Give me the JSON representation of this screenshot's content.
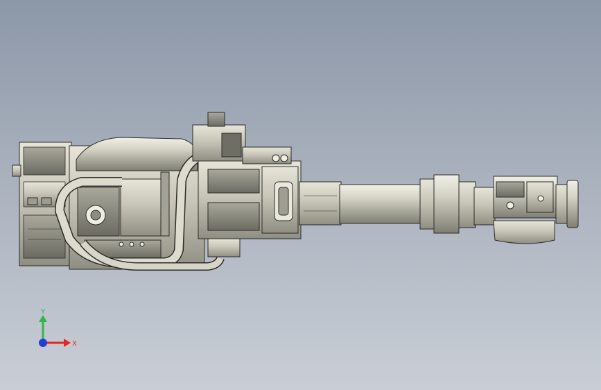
{
  "viewport": {
    "background_top": "#8c97a8",
    "background_bottom": "#c9ced6"
  },
  "model": {
    "name": "",
    "body_color": "#c7c6b8",
    "shadow_color": "#8f8e82",
    "line_color": "#2b2b28"
  },
  "triad": {
    "x_label": "X",
    "y_label": "Y",
    "x_color": "#e8251f",
    "y_color": "#2fb84a",
    "z_color": "#1f3fd6"
  }
}
